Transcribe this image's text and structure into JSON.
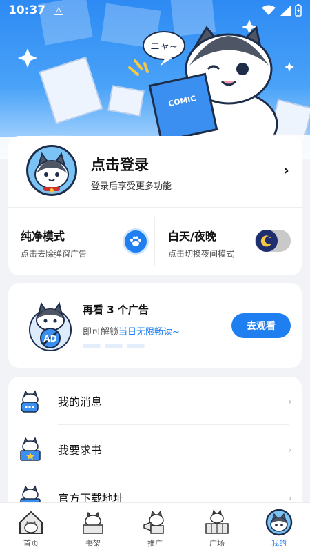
{
  "status_bar": {
    "time": "10:37",
    "notification_badge": "A"
  },
  "hero": {
    "speech_bubble": "ニャ~",
    "book_title": "COMIC"
  },
  "login": {
    "title": "点击登录",
    "subtitle": "登录后享受更多功能",
    "arrow": "›"
  },
  "modes": {
    "pure": {
      "title": "纯净模式",
      "subtitle": "点击去除弹窗广告"
    },
    "night": {
      "title": "白天/夜晚",
      "subtitle": "点击切换夜间模式"
    }
  },
  "ad": {
    "title": "再看 3 个广告",
    "desc_prefix": "即可解锁",
    "desc_highlight": "当日无限畅读~",
    "button": "去观看",
    "badge": "AD"
  },
  "menu": {
    "items": [
      {
        "label": "我的消息",
        "icon": "message-cat-icon"
      },
      {
        "label": "我要求书",
        "icon": "book-request-cat-icon"
      },
      {
        "label": "官方下载地址",
        "icon": "download-cat-icon"
      }
    ],
    "arrow": "›"
  },
  "tabs": [
    {
      "label": "首页",
      "icon": "home-icon",
      "active": false
    },
    {
      "label": "书架",
      "icon": "bookshelf-icon",
      "active": false
    },
    {
      "label": "推广",
      "icon": "promote-icon",
      "active": false
    },
    {
      "label": "广场",
      "icon": "square-icon",
      "active": false
    },
    {
      "label": "我的",
      "icon": "profile-icon",
      "active": true
    }
  ],
  "colors": {
    "accent": "#1f7ef0",
    "hero_top": "#2d8af3",
    "background": "#f2f3f7",
    "night_knob": "#1e2e6e"
  }
}
